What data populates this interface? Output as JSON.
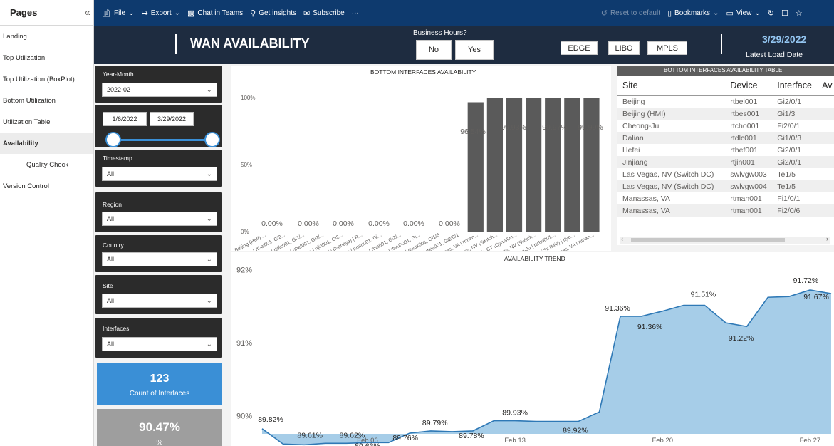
{
  "pages_panel": {
    "title": "Pages",
    "collapse_icon": "double-chevron-left-icon",
    "items": [
      {
        "label": "Landing",
        "active": false,
        "sub": false
      },
      {
        "label": "Top Utilization",
        "active": false,
        "sub": false
      },
      {
        "label": "Top Utilization (BoxPlot)",
        "active": false,
        "sub": false
      },
      {
        "label": "Bottom Utilization",
        "active": false,
        "sub": false
      },
      {
        "label": "Utilization Table",
        "active": false,
        "sub": false
      },
      {
        "label": "Availability",
        "active": true,
        "sub": false
      },
      {
        "label": "Quality Check",
        "active": false,
        "sub": true
      },
      {
        "label": "Version Control",
        "active": false,
        "sub": false
      }
    ]
  },
  "toolbar": {
    "file": "File",
    "export": "Export",
    "chat": "Chat in Teams",
    "insights": "Get insights",
    "subscribe": "Subscribe",
    "more": "···",
    "reset": "Reset to default",
    "bookmarks": "Bookmarks",
    "view": "View"
  },
  "header": {
    "title": "WAN AVAILABILITY",
    "business_hours_label": "Business Hours?",
    "no_label": "No",
    "yes_label": "Yes",
    "edge_label": "EDGE",
    "libo_label": "LIBO",
    "mpls_label": "MPLS",
    "date": "3/29/2022",
    "latest_load_label": "Latest Load Date"
  },
  "slicers": {
    "year_month": {
      "label": "Year-Month",
      "value": "2022-02"
    },
    "date_range": {
      "start": "1/6/2022",
      "end": "3/29/2022"
    },
    "timestamp": {
      "label": "Timestamp",
      "value": "All"
    },
    "region": {
      "label": "Region",
      "value": "All"
    },
    "country": {
      "label": "Country",
      "value": "All"
    },
    "site": {
      "label": "Site",
      "value": "All"
    },
    "interfaces": {
      "label": "Interfaces",
      "value": "All"
    }
  },
  "kpis": {
    "count_value": "123",
    "count_label": "Count of Interfaces",
    "pct_value": "90.47%",
    "pct_label": "%"
  },
  "colors": {
    "command_bar": "#0e3a6e",
    "header": "#1e2c40",
    "slicer_bg": "#2b2b2b",
    "kpi_count": "#3a8fd6",
    "kpi_pct": "#9e9e9e",
    "bar": "#5a5a5a",
    "area": "#a6cde8",
    "line": "#2f79b6",
    "date_accent": "#93c5f0"
  },
  "bar_chart": {
    "title": "BOTTOM INTERFACES AVAILABILITY",
    "y_ticks": [
      "100%",
      "50%",
      "0%"
    ]
  },
  "table": {
    "title": "BOTTOM INTERFACES AVAILABILITY TABLE",
    "columns": [
      "Site",
      "Device",
      "Interface",
      "Av"
    ],
    "rows": [
      [
        "Beijing",
        "rtbei001",
        "Gi2/0/1"
      ],
      [
        "Beijing (HMI)",
        "rtbes001",
        "Gi1/3"
      ],
      [
        "Cheong-Ju",
        "rtcho001",
        "Fi2/0/1"
      ],
      [
        "Dalian",
        "rtdlc001",
        "Gi1/0/3"
      ],
      [
        "Hefei",
        "rthef001",
        "Gi2/0/1"
      ],
      [
        "Jinjiang",
        "rtjin001",
        "Gi2/0/1"
      ],
      [
        "Las Vegas, NV (Switch DC)",
        "swlvgw003",
        "Te1/5"
      ],
      [
        "Las Vegas, NV (Switch DC)",
        "swlvgw004",
        "Te1/5"
      ],
      [
        "Manassas, VA",
        "rtman001",
        "Fi1/0/1"
      ],
      [
        "Manassas, VA",
        "rtman001",
        "Fi2/0/6"
      ]
    ]
  },
  "trend": {
    "title": "AVAILABILITY TREND",
    "y_ticks": [
      "92%",
      "91%",
      "90%"
    ],
    "x_ticks": [
      "Feb 06",
      "Feb 13",
      "Feb 20",
      "Feb 27"
    ]
  },
  "chart_data": [
    {
      "type": "bar",
      "title": "BOTTOM INTERFACES AVAILABILITY",
      "ylim": [
        0,
        100
      ],
      "categories": [
        "Beijing (HMI) ...",
        "Beijing | rtbei001, Gi2...",
        "Dalian | rtdlc001, Gi1/...",
        "Hefei | rthef001, Gi2/...",
        "Jinjiang | rtjin001, Gi2...",
        "Nagasaki (Isahaya) | R...",
        "Nanjing | rtnan001, Gi...",
        "Tianjin | rttia001, Gi2/...",
        "Wuhan | rtwuh001, Gi...",
        "Wuxi | rtwux001, Gi1/3",
        "Xian | rtxia001, Gi2/0/1",
        "Manassas, VA | rtman...",
        "Las Vegas, NV (Switch...",
        "Norwalk, CT (CyrusOn...",
        "Las Vegas, NV (Switch...",
        "Cheong-Ju | rtcho001...",
        "Yokkaichi (Mie) | rtyo...",
        "Manassas, VA | rtman..."
      ],
      "values": [
        0,
        0,
        0,
        0,
        0,
        0,
        0,
        0,
        0,
        0,
        0,
        96.54,
        99.93,
        99.93,
        99.97,
        99.97,
        99.99,
        99.99
      ],
      "data_labels": [
        "0.00%",
        "0.00%",
        "0.00%",
        "0.00%",
        "0.00%",
        "0.00%",
        "96.54%",
        "99.93%",
        "99.97%",
        "99.99%"
      ]
    },
    {
      "type": "area",
      "title": "AVAILABILITY TREND",
      "ylim": [
        89.75,
        92.1
      ],
      "y_ticks": [
        92,
        91,
        90
      ],
      "x": [
        "Feb 01",
        "Feb 02",
        "Feb 03",
        "Feb 04",
        "Feb 05",
        "Feb 06",
        "Feb 07",
        "Feb 08",
        "Feb 09",
        "Feb 10",
        "Feb 11",
        "Feb 12",
        "Feb 13",
        "Feb 14",
        "Feb 15",
        "Feb 16",
        "Feb 17",
        "Feb 18",
        "Feb 19",
        "Feb 20",
        "Feb 21",
        "Feb 22",
        "Feb 23",
        "Feb 24",
        "Feb 25",
        "Feb 26",
        "Feb 27",
        "Feb 28"
      ],
      "values": [
        89.82,
        89.61,
        89.6,
        89.62,
        89.62,
        89.63,
        89.63,
        89.76,
        89.79,
        89.78,
        89.79,
        89.93,
        89.93,
        89.92,
        89.92,
        89.92,
        90.05,
        91.36,
        91.36,
        91.43,
        91.51,
        91.51,
        91.27,
        91.22,
        91.62,
        91.63,
        91.72,
        91.67
      ],
      "data_labels": [
        {
          "i": 0,
          "text": "89.82%"
        },
        {
          "i": 2,
          "text": "89.61%"
        },
        {
          "i": 4,
          "text": "89.62%"
        },
        {
          "i": 5,
          "text": "89.63%"
        },
        {
          "i": 7,
          "text": "89.76%"
        },
        {
          "i": 8,
          "text": "89.79%"
        },
        {
          "i": 10,
          "text": "89.78%"
        },
        {
          "i": 12,
          "text": "89.93%"
        },
        {
          "i": 15,
          "text": "89.92%"
        },
        {
          "i": 17,
          "text": "91.36%"
        },
        {
          "i": 18,
          "text": "91.36%"
        },
        {
          "i": 21,
          "text": "91.51%"
        },
        {
          "i": 23,
          "text": "91.22%"
        },
        {
          "i": 26,
          "text": "91.72%"
        },
        {
          "i": 27,
          "text": "91.67%"
        }
      ]
    }
  ]
}
